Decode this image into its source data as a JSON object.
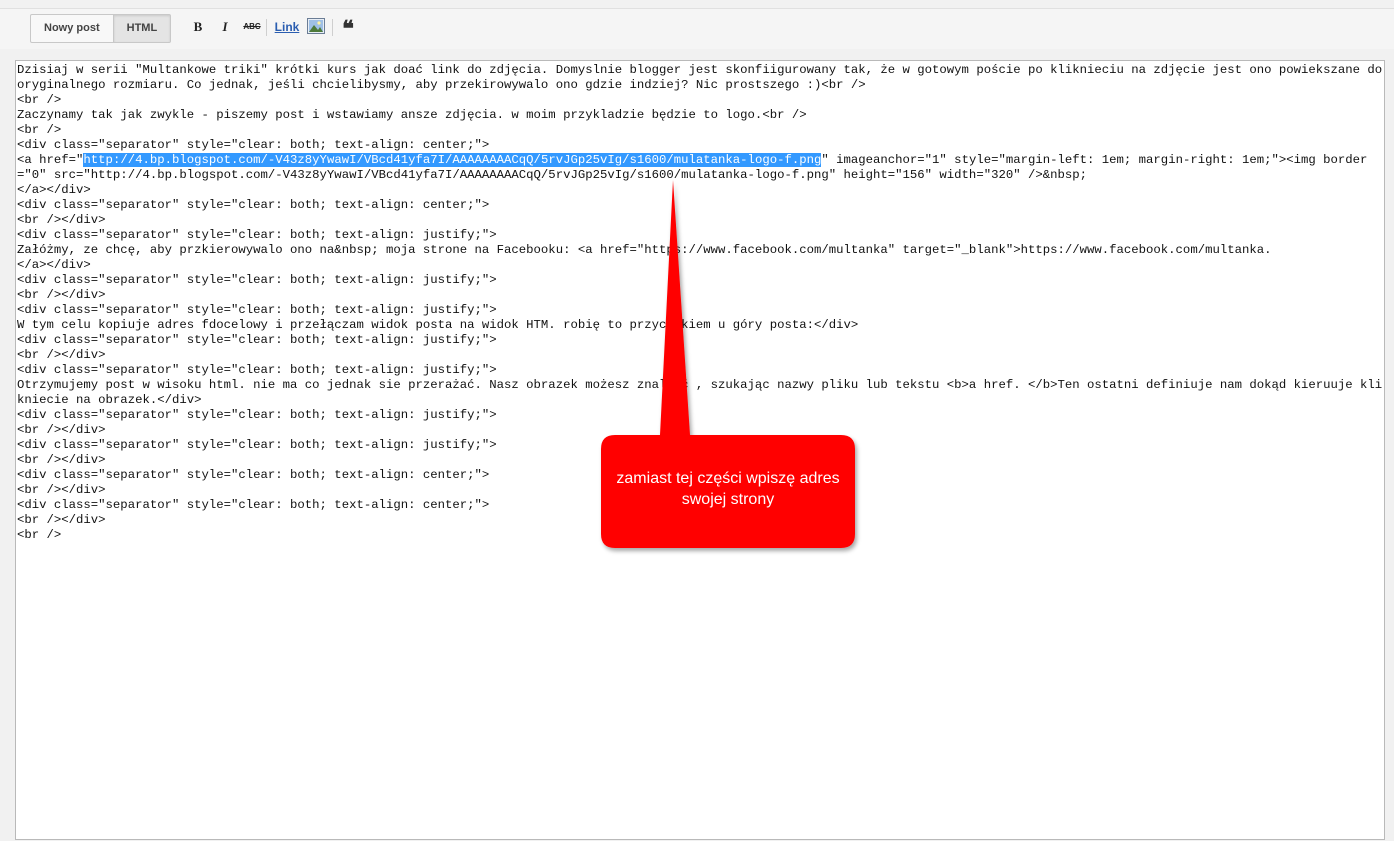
{
  "toolbar": {
    "tabs": [
      {
        "label": "Nowy post",
        "active": false
      },
      {
        "label": "HTML",
        "active": true
      }
    ],
    "bold_label": "B",
    "italic_label": "I",
    "strike_label": "ABC",
    "link_label": "Link",
    "image_icon": "image-icon",
    "quote_label": "❝"
  },
  "editor": {
    "lines": [
      "Dzisiaj w serii \"Multankowe triki\" krótki kurs jak doać link do zdjęcia. Domyslnie blogger jest skonfiigurowany tak, że w gotowym poście po kliknieciu na zdjęcie jest ono powiekszane do oryginalnego rozmiaru. Co jednak, jeśli chcielibysmy, aby przekirowywalo ono gdzie indziej? Nic prostszego :)<br />",
      "<br />",
      "Zaczynamy tak jak zwykle - piszemy post i wstawiamy ansze zdjęcia. w moim przykladzie będzie to logo.<br />",
      "<br />",
      "<div class=\"separator\" style=\"clear: both; text-align: center;\">",
      {
        "before": "<a href=\"",
        "highlight": "http://4.bp.blogspot.com/-V43z8yYwawI/VBcd41yfa7I/AAAAAAAACqQ/5rvJGp25vIg/s1600/mulatanka-logo-f.png",
        "after": "\" imageanchor=\"1\" style=\"margin-left: 1em; margin-right: 1em;\"><img border=\"0\" src=\"http://4.bp.blogspot.com/-V43z8yYwawI/VBcd41yfa7I/AAAAAAAACqQ/5rvJGp25vIg/s1600/mulatanka-logo-f.png\" height=\"156\" width=\"320\" />&nbsp;"
      },
      "</a></div>",
      "<div class=\"separator\" style=\"clear: both; text-align: center;\">",
      "<br /></div>",
      "<div class=\"separator\" style=\"clear: both; text-align: justify;\">",
      "Załóżmy, ze chcę, aby przkierowywalo ono na&nbsp; moja strone na Facebooku: <a href=\"https://www.facebook.com/multanka\" target=\"_blank\">https://www.facebook.com/multanka.",
      "</a></div>",
      "<div class=\"separator\" style=\"clear: both; text-align: justify;\">",
      "<br /></div>",
      "<div class=\"separator\" style=\"clear: both; text-align: justify;\">",
      "W tym celu kopiuje adres fdocelowy i przełączam widok posta na widok HTM. robię to przyciskiem u góry posta:</div>",
      "<div class=\"separator\" style=\"clear: both; text-align: justify;\">",
      "<br /></div>",
      "<div class=\"separator\" style=\"clear: both; text-align: justify;\">",
      "Otrzymujemy post w wisoku html. nie ma co jednak sie przerażać. Nasz obrazek możesz znaleźć , szukając nazwy pliku lub tekstu <b>a href. </b>Ten ostatni definiuje nam dokąd kieruuje klikniecie na obrazek.</div>",
      "<div class=\"separator\" style=\"clear: both; text-align: justify;\">",
      "<br /></div>",
      "<div class=\"separator\" style=\"clear: both; text-align: justify;\">",
      "<br /></div>",
      "<div class=\"separator\" style=\"clear: both; text-align: center;\">",
      "<br /></div>",
      "<div class=\"separator\" style=\"clear: both; text-align: center;\">",
      "<br /></div>",
      "<br />"
    ]
  },
  "callout": {
    "text": "zamiast tej części wpiszę adres swojej strony",
    "color": "#ff0000"
  }
}
